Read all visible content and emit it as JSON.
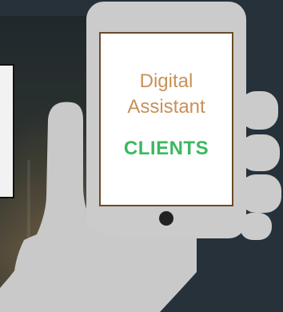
{
  "phone": {
    "title": "Digital Assistant",
    "label": "CLIENTS"
  },
  "colors": {
    "background": "#26313a",
    "phone_body": "#cbcbcb",
    "screen_border": "#6b4a2a",
    "title_color": "#c89157",
    "label_color": "#3cb860"
  },
  "icons": [
    "phone-in-hand-illustration",
    "home-button-icon"
  ]
}
